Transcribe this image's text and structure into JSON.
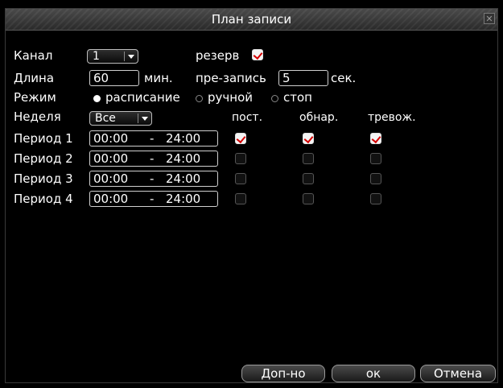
{
  "window": {
    "title": "План записи"
  },
  "form": {
    "channel_label": "Канал",
    "channel_value": "1",
    "reserve_label": "резерв",
    "reserve_checked": true,
    "length_label": "Длина",
    "length_value": "60",
    "length_unit": "мин.",
    "prerecord_label": "пре-запись",
    "prerecord_value": "5",
    "prerecord_unit": "сек.",
    "mode_label": "Режим",
    "mode_options": [
      "расписание",
      "ручной",
      "стоп"
    ],
    "mode_selected": "расписание",
    "week_label": "Неделя",
    "week_value": "Все"
  },
  "columns": {
    "regular": "пост.",
    "detect": "обнар.",
    "alarm": "тревож."
  },
  "periods": [
    {
      "label": "Период 1",
      "start": "00:00",
      "dash": "-",
      "end": "24:00",
      "regular": true,
      "detect": true,
      "alarm": true
    },
    {
      "label": "Период 2",
      "start": "00:00",
      "dash": "-",
      "end": "24:00",
      "regular": false,
      "detect": false,
      "alarm": false
    },
    {
      "label": "Период 3",
      "start": "00:00",
      "dash": "-",
      "end": "24:00",
      "regular": false,
      "detect": false,
      "alarm": false
    },
    {
      "label": "Период 4",
      "start": "00:00",
      "dash": "-",
      "end": "24:00",
      "regular": false,
      "detect": false,
      "alarm": false
    }
  ],
  "buttons": {
    "advanced": "Доп-но",
    "ok": "ок",
    "cancel": "Отмена"
  },
  "icons": {
    "close": "close-icon",
    "dropdown": "chevron-down-icon",
    "check": "checkmark-icon"
  },
  "colors": {
    "check_mark": "#d40000",
    "background": "#000000"
  }
}
